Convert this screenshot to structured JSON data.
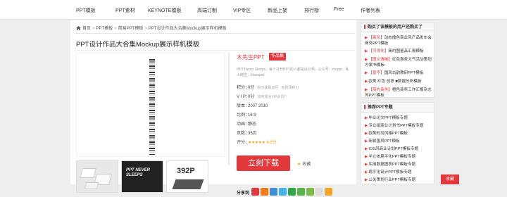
{
  "nav": {
    "items": [
      "PPT模板",
      "PPT素材",
      "KEYNOTE模板",
      "高端订制",
      "VIP专区",
      "新品上架",
      "排行榜",
      "Free",
      "作者列表"
    ]
  },
  "breadcrumb": {
    "home": "首页",
    "items": [
      "PPT模板",
      "简易PPT模板",
      "PPT设计作品大合集Mockup展示样机模板"
    ]
  },
  "page_title": "PPT设计作品大合集Mockup展示样机模板",
  "thumbs": {
    "thumb2_line1": "PPT NEVER",
    "thumb2_line2": "SLEEPS",
    "thumb3_text": "392P"
  },
  "info": {
    "author": "木先生PPT",
    "author_badge": "作品集",
    "description": "PPT Never Sleeps，每个打开PPT的人都是设计师。公众号：muppt，私人微信：bluespot",
    "points_label": "积分：",
    "points_value": "0分",
    "points_note1": "积分获取途径",
    "points_note2": "免费领积分",
    "vip_label": "V I P：",
    "vip_value": "0分",
    "vip_link": "如何成为VIP会员？",
    "version_label": "版本：",
    "version_value": "2007   2010",
    "ratio_label": "比例：",
    "ratio_value": "16:9",
    "anim_label": "动画：",
    "anim_value": "静态",
    "pages_label": "页数：",
    "pages_value": "35页",
    "rating_label": "评分：",
    "rating_stars": 5,
    "rating_value": "4.8分",
    "download_label": "立刻下载",
    "fav_label": "收藏"
  },
  "share": {
    "label": "分享到",
    "icon_colors": [
      "#e4393c",
      "#f47a20",
      "#3d8fd6",
      "#46b3e6",
      "#2fa844",
      "#5ab348",
      "#7bbd45",
      "#dddddd",
      "#f6a623"
    ]
  },
  "sidebar": {
    "box1_title": "购买了该模板的用户还购买了",
    "box1_items": [
      {
        "tag": "【画风】",
        "text": "动态撞色商业风产品发布会商务PPT模板"
      },
      {
        "tag": "【可视化】",
        "text": "简约图鉴品汇报模板"
      },
      {
        "tag": "【图文清晰】",
        "text": "红色商务大气活动策划方案书模板"
      },
      {
        "tag": "【普华】",
        "text": "国风古韵教研PPT模板"
      },
      {
        "tag": "",
        "text": "欧美 红色 创意 ■数据分析模板"
      },
      {
        "tag": "【简约商务】",
        "text": "橙色商务工作汇报杂志风PPT模板"
      }
    ],
    "box2_title": "推荐PPT专题",
    "box2_items": [
      "毕业论文PPT模板专题",
      "专业级商业计划书PPT模板专题",
      "欧美时尚风格PPT模板",
      "新颖国风PPT模板",
      "IOS风商业计划PPT模板专题",
      "半立体扁平化PPT模板专题",
      "实用数据图表PPT模板专题",
      "扁平化设计PPT模板专题",
      "公关策划行业PPT模板专题"
    ]
  },
  "scroll_top_label": "收藏",
  "colors": {
    "accent": "#e4393c",
    "star": "#f5a623",
    "background": "#eeeeee"
  }
}
